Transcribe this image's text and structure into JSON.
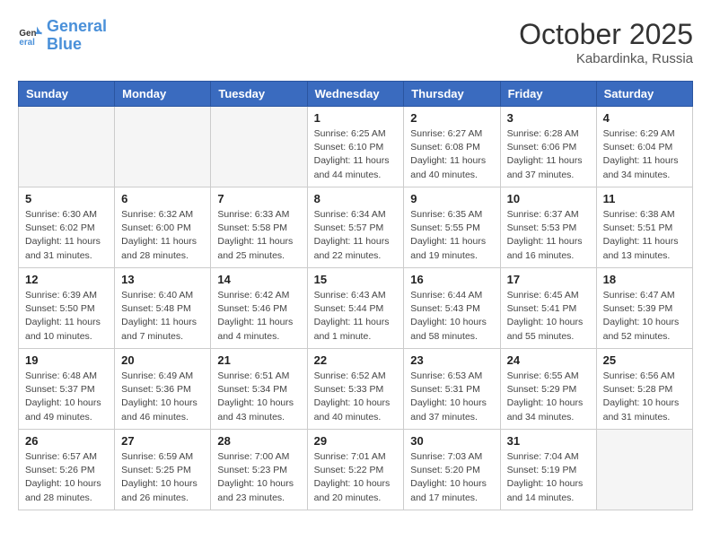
{
  "header": {
    "logo_line1": "General",
    "logo_line2": "Blue",
    "month": "October 2025",
    "location": "Kabardinka, Russia"
  },
  "weekdays": [
    "Sunday",
    "Monday",
    "Tuesday",
    "Wednesday",
    "Thursday",
    "Friday",
    "Saturday"
  ],
  "weeks": [
    [
      {
        "day": "",
        "info": ""
      },
      {
        "day": "",
        "info": ""
      },
      {
        "day": "",
        "info": ""
      },
      {
        "day": "1",
        "info": "Sunrise: 6:25 AM\nSunset: 6:10 PM\nDaylight: 11 hours\nand 44 minutes."
      },
      {
        "day": "2",
        "info": "Sunrise: 6:27 AM\nSunset: 6:08 PM\nDaylight: 11 hours\nand 40 minutes."
      },
      {
        "day": "3",
        "info": "Sunrise: 6:28 AM\nSunset: 6:06 PM\nDaylight: 11 hours\nand 37 minutes."
      },
      {
        "day": "4",
        "info": "Sunrise: 6:29 AM\nSunset: 6:04 PM\nDaylight: 11 hours\nand 34 minutes."
      }
    ],
    [
      {
        "day": "5",
        "info": "Sunrise: 6:30 AM\nSunset: 6:02 PM\nDaylight: 11 hours\nand 31 minutes."
      },
      {
        "day": "6",
        "info": "Sunrise: 6:32 AM\nSunset: 6:00 PM\nDaylight: 11 hours\nand 28 minutes."
      },
      {
        "day": "7",
        "info": "Sunrise: 6:33 AM\nSunset: 5:58 PM\nDaylight: 11 hours\nand 25 minutes."
      },
      {
        "day": "8",
        "info": "Sunrise: 6:34 AM\nSunset: 5:57 PM\nDaylight: 11 hours\nand 22 minutes."
      },
      {
        "day": "9",
        "info": "Sunrise: 6:35 AM\nSunset: 5:55 PM\nDaylight: 11 hours\nand 19 minutes."
      },
      {
        "day": "10",
        "info": "Sunrise: 6:37 AM\nSunset: 5:53 PM\nDaylight: 11 hours\nand 16 minutes."
      },
      {
        "day": "11",
        "info": "Sunrise: 6:38 AM\nSunset: 5:51 PM\nDaylight: 11 hours\nand 13 minutes."
      }
    ],
    [
      {
        "day": "12",
        "info": "Sunrise: 6:39 AM\nSunset: 5:50 PM\nDaylight: 11 hours\nand 10 minutes."
      },
      {
        "day": "13",
        "info": "Sunrise: 6:40 AM\nSunset: 5:48 PM\nDaylight: 11 hours\nand 7 minutes."
      },
      {
        "day": "14",
        "info": "Sunrise: 6:42 AM\nSunset: 5:46 PM\nDaylight: 11 hours\nand 4 minutes."
      },
      {
        "day": "15",
        "info": "Sunrise: 6:43 AM\nSunset: 5:44 PM\nDaylight: 11 hours\nand 1 minute."
      },
      {
        "day": "16",
        "info": "Sunrise: 6:44 AM\nSunset: 5:43 PM\nDaylight: 10 hours\nand 58 minutes."
      },
      {
        "day": "17",
        "info": "Sunrise: 6:45 AM\nSunset: 5:41 PM\nDaylight: 10 hours\nand 55 minutes."
      },
      {
        "day": "18",
        "info": "Sunrise: 6:47 AM\nSunset: 5:39 PM\nDaylight: 10 hours\nand 52 minutes."
      }
    ],
    [
      {
        "day": "19",
        "info": "Sunrise: 6:48 AM\nSunset: 5:37 PM\nDaylight: 10 hours\nand 49 minutes."
      },
      {
        "day": "20",
        "info": "Sunrise: 6:49 AM\nSunset: 5:36 PM\nDaylight: 10 hours\nand 46 minutes."
      },
      {
        "day": "21",
        "info": "Sunrise: 6:51 AM\nSunset: 5:34 PM\nDaylight: 10 hours\nand 43 minutes."
      },
      {
        "day": "22",
        "info": "Sunrise: 6:52 AM\nSunset: 5:33 PM\nDaylight: 10 hours\nand 40 minutes."
      },
      {
        "day": "23",
        "info": "Sunrise: 6:53 AM\nSunset: 5:31 PM\nDaylight: 10 hours\nand 37 minutes."
      },
      {
        "day": "24",
        "info": "Sunrise: 6:55 AM\nSunset: 5:29 PM\nDaylight: 10 hours\nand 34 minutes."
      },
      {
        "day": "25",
        "info": "Sunrise: 6:56 AM\nSunset: 5:28 PM\nDaylight: 10 hours\nand 31 minutes."
      }
    ],
    [
      {
        "day": "26",
        "info": "Sunrise: 6:57 AM\nSunset: 5:26 PM\nDaylight: 10 hours\nand 28 minutes."
      },
      {
        "day": "27",
        "info": "Sunrise: 6:59 AM\nSunset: 5:25 PM\nDaylight: 10 hours\nand 26 minutes."
      },
      {
        "day": "28",
        "info": "Sunrise: 7:00 AM\nSunset: 5:23 PM\nDaylight: 10 hours\nand 23 minutes."
      },
      {
        "day": "29",
        "info": "Sunrise: 7:01 AM\nSunset: 5:22 PM\nDaylight: 10 hours\nand 20 minutes."
      },
      {
        "day": "30",
        "info": "Sunrise: 7:03 AM\nSunset: 5:20 PM\nDaylight: 10 hours\nand 17 minutes."
      },
      {
        "day": "31",
        "info": "Sunrise: 7:04 AM\nSunset: 5:19 PM\nDaylight: 10 hours\nand 14 minutes."
      },
      {
        "day": "",
        "info": ""
      }
    ]
  ]
}
